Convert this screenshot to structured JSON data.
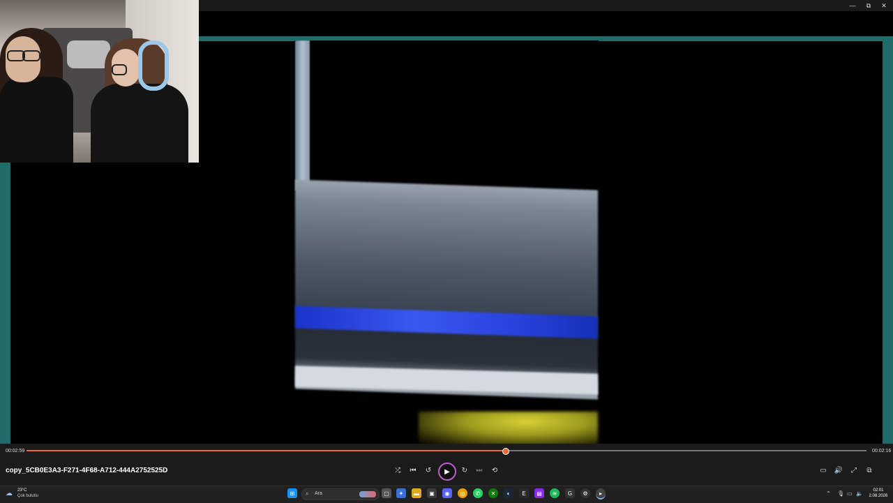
{
  "window": {
    "minimize_glyph": "—",
    "maximize_glyph": "⧉",
    "close_glyph": "✕"
  },
  "player": {
    "current_time": "00:02:59",
    "total_time": "00:02:16",
    "progress_fraction": 0.57,
    "filename": "copy_5CB0E3A3-F271-4F68-A712-444A2752525D",
    "accent_color": "#e86d3a"
  },
  "controls": {
    "shuffle_icon": "⤮",
    "previous_icon": "⏮",
    "rewind_icon": "↺",
    "play_icon": "▶",
    "forward_icon": "↻",
    "next_icon": "⏭",
    "repeat_icon": "⟲",
    "miniplayer_icon": "▭",
    "volume_icon": "🔊",
    "fullscreen_icon": "⤢",
    "more_icon": "⧉"
  },
  "taskbar": {
    "weather_temp": "23°C",
    "weather_desc": "Çok bulutlu",
    "search_placeholder": "Ara",
    "clock_time": "02:01",
    "clock_date": "2.08.2026"
  }
}
